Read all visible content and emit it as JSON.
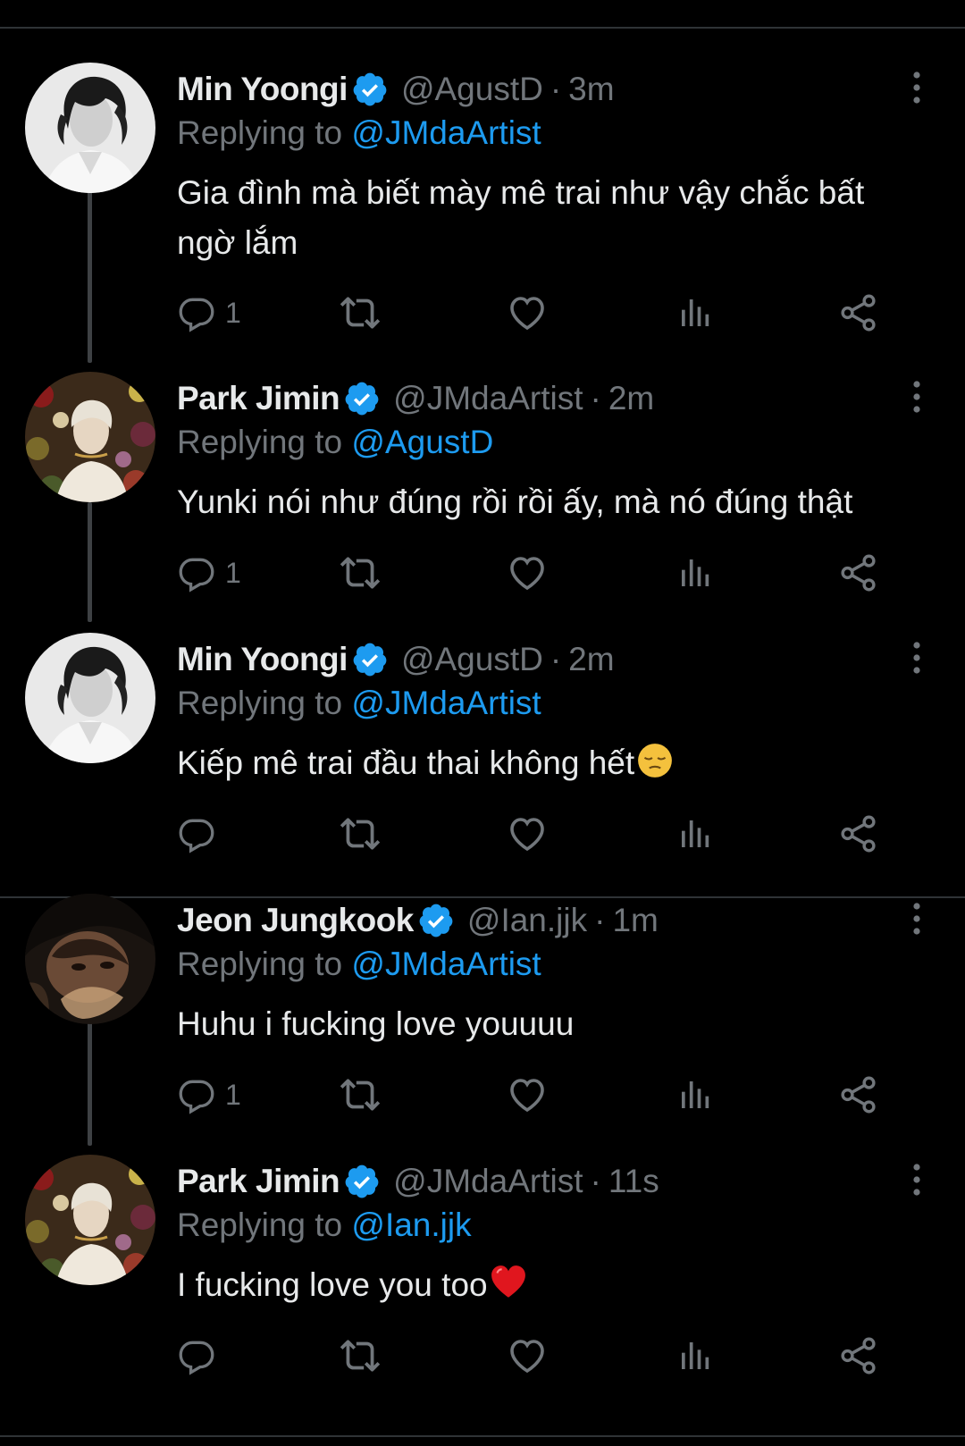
{
  "colors": {
    "background": "#000000",
    "text": "#e7e9ea",
    "secondary": "#71767b",
    "accent": "#1d9bf0",
    "divider": "#2f3336"
  },
  "reply_prefix": "Replying to",
  "tweets": [
    {
      "name": "Min Yoongi",
      "handle": "@AgustD",
      "separator": "·",
      "time": "3m",
      "reply_to": "@JMdaArtist",
      "text": "Gia đình mà biết mày mê trai như vậy chắc bất ngờ lắm",
      "reply_count": "1",
      "avatar": "avatar-min-yoongi"
    },
    {
      "name": "Park Jimin",
      "handle": "@JMdaArtist",
      "separator": "·",
      "time": "2m",
      "reply_to": "@AgustD",
      "text": "Yunki nói như đúng rồi rồi ấy, mà nó đúng thật",
      "reply_count": "1",
      "avatar": "avatar-park-jimin"
    },
    {
      "name": "Min Yoongi",
      "handle": "@AgustD",
      "separator": "·",
      "time": "2m",
      "reply_to": "@JMdaArtist",
      "text": "Kiếp mê trai đầu thai không hết",
      "emoji": "pensive-face-emoji",
      "reply_count": "",
      "avatar": "avatar-min-yoongi"
    },
    {
      "name": "Jeon Jungkook",
      "handle": "@Ian.jjk",
      "separator": "·",
      "time": "1m",
      "reply_to": "@JMdaArtist",
      "text": "Huhu i fucking love youuuu",
      "reply_count": "1",
      "avatar": "avatar-jeon-jungkook"
    },
    {
      "name": "Park Jimin",
      "handle": "@JMdaArtist",
      "separator": "·",
      "time": "11s",
      "reply_to": "@Ian.jjk",
      "text": "I fucking love you too",
      "emoji": "red-heart-emoji",
      "reply_count": "",
      "avatar": "avatar-park-jimin"
    }
  ],
  "icons": [
    "reply-icon",
    "retweet-icon",
    "like-icon",
    "views-icon",
    "share-icon",
    "verified-badge-icon",
    "more-options-icon"
  ]
}
